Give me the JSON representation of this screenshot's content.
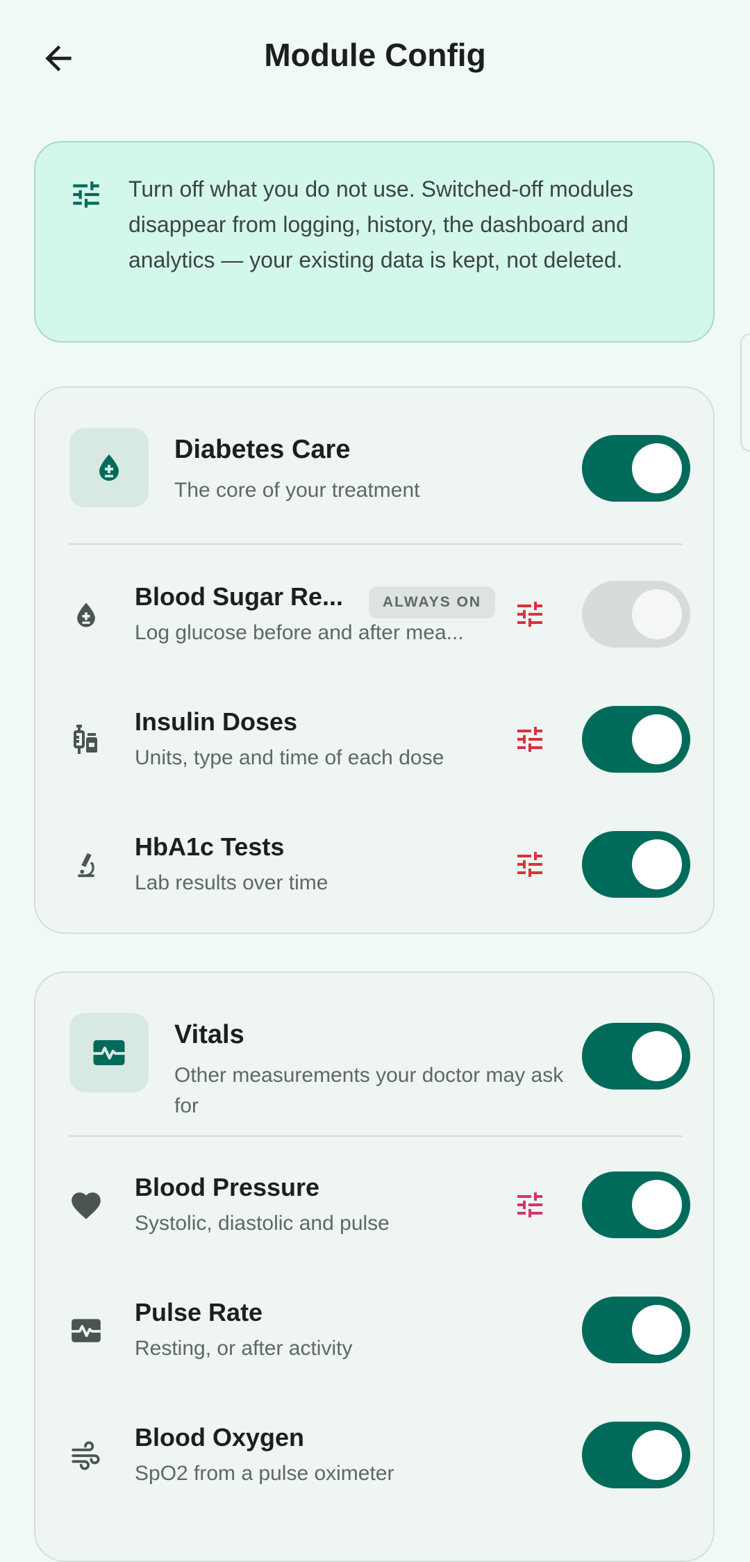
{
  "appbar": {
    "title": "Module Config",
    "back_icon": "arrow-left-icon"
  },
  "info": {
    "icon": "tune-icon",
    "text": "Turn off what you do not use. Switched-off modules disappear from logging, history, the dashboard and analytics — your existing data is kept, not deleted."
  },
  "groups": [
    {
      "title": "Diabetes Care",
      "subtitle": "The core of your treatment",
      "icon": "blood-drop-icon",
      "enabled": true,
      "modules": [
        {
          "title": "Blood Sugar Re...",
          "subtitle": "Log glucose before and after mea...",
          "icon": "blood-drop-icon",
          "badge": "ALWAYS ON",
          "has_settings": true,
          "enabled": true,
          "locked": true
        },
        {
          "title": "Insulin Doses",
          "subtitle": "Units, type and time of each dose",
          "icon": "syringe-vial-icon",
          "has_settings": true,
          "enabled": true
        },
        {
          "title": "HbA1c Tests",
          "subtitle": "Lab results over time",
          "icon": "microscope-icon",
          "has_settings": true,
          "enabled": true
        }
      ]
    },
    {
      "title": "Vitals",
      "subtitle": "Other measurements your doctor may ask for",
      "icon": "monitor-heart-icon",
      "enabled": true,
      "modules": [
        {
          "title": "Blood Pressure",
          "subtitle": "Systolic, diastolic and pulse",
          "icon": "heart-icon",
          "has_settings": true,
          "enabled": true
        },
        {
          "title": "Pulse Rate",
          "subtitle": "Resting, or after activity",
          "icon": "monitor-heart-icon",
          "has_settings": false,
          "enabled": true
        },
        {
          "title": "Blood Oxygen",
          "subtitle": "SpO2 from a pulse oximeter",
          "icon": "air-icon",
          "has_settings": false,
          "enabled": true
        }
      ]
    }
  ],
  "colors": {
    "background": "#F1F9F6",
    "primary": "#006B5A",
    "info_bg": "#D4F7EC",
    "card_bg": "#EEF5F2",
    "tune_red": "#D9333B",
    "tune_pink": "#D6336C",
    "icon_gray": "#4A5452",
    "toggle_disabled": "#D7DCDA"
  }
}
